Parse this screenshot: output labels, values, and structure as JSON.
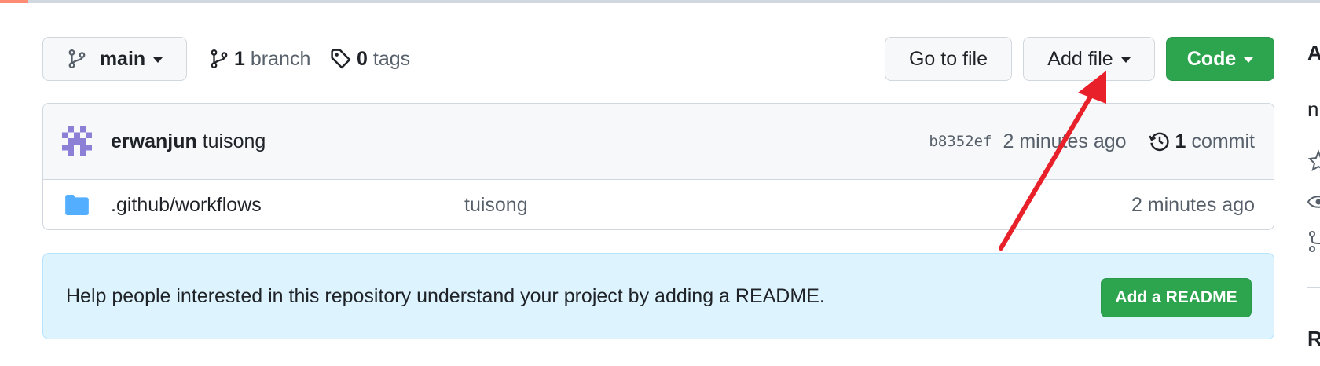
{
  "branch_selector": {
    "label": "main"
  },
  "branches": {
    "count": "1",
    "label": "branch"
  },
  "tags": {
    "count": "0",
    "label": "tags"
  },
  "actions": {
    "go_to_file": "Go to file",
    "add_file": "Add file",
    "code": "Code"
  },
  "latest_commit": {
    "author": "erwanjun",
    "message": "tuisong",
    "sha": "b8352ef",
    "time": "2 minutes ago",
    "count": "1",
    "count_label": "commit"
  },
  "files": [
    {
      "name": ".github/workflows",
      "message": "tuisong",
      "time": "2 minutes ago"
    }
  ],
  "readme_prompt": {
    "text": "Help people interested in this repository understand your project by adding a README.",
    "button": "Add a README"
  },
  "sidebar_peek": {
    "about_initial": "A",
    "desc_initial": "n",
    "releases_initial": "R"
  },
  "colors": {
    "primary_green": "#2da44e",
    "folder_blue": "#54aeff",
    "annotation_red": "#e8202a",
    "info_bg": "#ddf4ff"
  },
  "annotation": {
    "type": "red-arrow",
    "points_to": "add-file-button"
  }
}
